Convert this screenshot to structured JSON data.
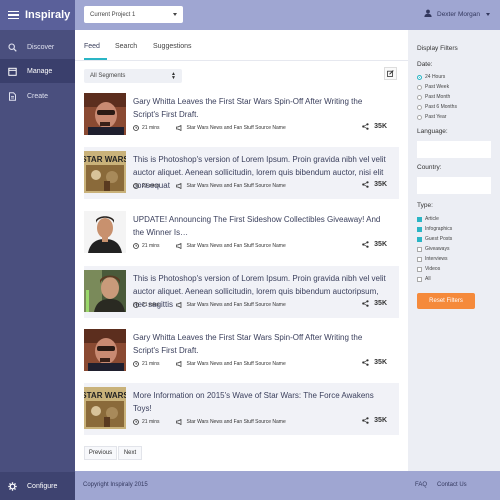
{
  "app": {
    "brand": "Inspiraly"
  },
  "sidebar": {
    "items": [
      {
        "label": "Discover",
        "icon": "search-icon"
      },
      {
        "label": "Manage",
        "icon": "calendar-icon"
      },
      {
        "label": "Create",
        "icon": "document-icon"
      }
    ],
    "configure": "Configure"
  },
  "topbar": {
    "project": "Current Project 1",
    "user": "Dexter Morgan"
  },
  "tabs": [
    "Feed",
    "Search",
    "Suggestions"
  ],
  "segments": {
    "selected": "All Segments"
  },
  "feed": [
    {
      "title": "Gary Whitta Leaves the First Star Wars Spin-Off After Writing the Script's First Draft.",
      "time": "21 mins",
      "source": "Star Wars News and Fan Stuff Source Name",
      "shares": "35K"
    },
    {
      "title": "This is Photoshop's version  of Lorem Ipsum. Proin gravida nibh vel velit auctor aliquet. Aenean sollicitudin, lorem quis bibendum auctor, nisi elit consequat",
      "time": "21 mins",
      "source": "Star Wars News and Fan Stuff Source Name",
      "shares": "35K"
    },
    {
      "title": "UPDATE! Announcing The First Sideshow Collectibles Giveaway! And the Winner Is…",
      "time": "21 mins",
      "source": "Star Wars News and Fan Stuff Source Name",
      "shares": "35K"
    },
    {
      "title": "This is Photoshop's version  of Lorem Ipsum. Proin gravida nibh vel velit auctor aliquet. Aenean sollicitudin, lorem quis bibendum auctoripsum, nec sagittis",
      "time": "21 mins",
      "source": "Star Wars News and Fan Stuff Source Name",
      "shares": "35K"
    },
    {
      "title": "Gary Whitta Leaves the First Star Wars Spin-Off After Writing the Script's First Draft.",
      "time": "21 mins",
      "source": "Star Wars News and Fan Stuff Source Name",
      "shares": "35K"
    },
    {
      "title": "More Information on 2015's Wave of Star Wars: The Force Awakens Toys!",
      "time": "21 mins",
      "source": "Star Wars News and Fan Stuff Source Name",
      "shares": "35K"
    }
  ],
  "thumbs": [
    "STAR WARS",
    "STAR WARS"
  ],
  "pager": {
    "previous": "Previous",
    "next": "Next"
  },
  "filters": {
    "title": "Display Filters",
    "date_label": "Date:",
    "dates": [
      "24 Hours",
      "Past Week",
      "Past Month",
      "Past 6 Months",
      "Past Year"
    ],
    "date_selected": "24 Hours",
    "language_label": "Language:",
    "country_label": "Country:",
    "type_label": "Type:",
    "types": [
      {
        "label": "Article",
        "checked": true
      },
      {
        "label": "Infographics",
        "checked": true
      },
      {
        "label": "Guest Posts",
        "checked": true
      },
      {
        "label": "Giveaways",
        "checked": false
      },
      {
        "label": "Interviews",
        "checked": false
      },
      {
        "label": "Videos",
        "checked": false
      },
      {
        "label": "All",
        "checked": false
      }
    ],
    "reset": "Reset Filters"
  },
  "footer": {
    "copyright": "Copyright Inspiraly 2015",
    "faq": "FAQ",
    "contact": "Contact Us"
  },
  "colors": {
    "sidebar": "#4a4f7e",
    "topbar": "#9fa6d2",
    "accent": "#2ab5c5",
    "reset": "#f58a3b"
  }
}
